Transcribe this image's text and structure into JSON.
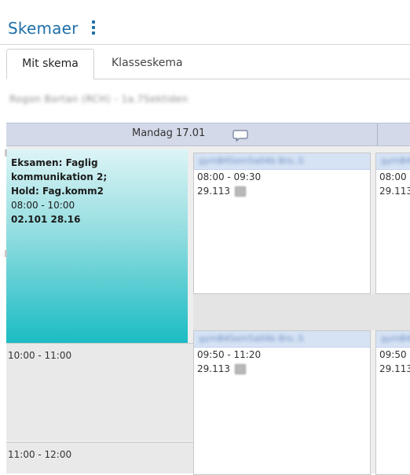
{
  "header": {
    "title": "Skemaer",
    "menu_icon": "kebab-menu-icon"
  },
  "tabs": [
    {
      "label": "Mit skema",
      "active": true
    },
    {
      "label": "Klasseskema",
      "active": false
    }
  ],
  "user": {
    "name_blurred": "Rogon Bortan (RCH) - 1a.7Sektiden"
  },
  "day": {
    "label": "Mandag 17.01",
    "comment_icon": "speech-bubble-icon"
  },
  "exam": {
    "title_line1": "Eksamen: Faglig",
    "title_line2": "kommunikation 2;",
    "hold": "Hold: Fag.komm2",
    "time": "08:00 - 10:00",
    "room": "02.101  28.16"
  },
  "time_slots": [
    {
      "label": "10:00 - 11:00"
    },
    {
      "label": "11:00 - 12:00"
    }
  ],
  "lessons": [
    {
      "header_blurred": "gymB4Sem5a04b Bro..S",
      "time": "08:00 - 09:30",
      "room": "29.113"
    },
    {
      "header_blurred": "gymB4Sem5",
      "time": "08:00",
      "room": "29.113"
    },
    {
      "header_blurred": "gymB4Sem5a04b Bro..S",
      "time": "09:50 - 11:20",
      "room": "29.113"
    },
    {
      "header_blurred": "gymB4Sem5",
      "time": "09:50",
      "room": "29.113"
    }
  ],
  "colors": {
    "title_blue": "#1f6fa8",
    "day_header_bg": "#d3d9e8",
    "exam_teal": "#1bbcc4",
    "card_header_bg": "#d6e3f5"
  }
}
